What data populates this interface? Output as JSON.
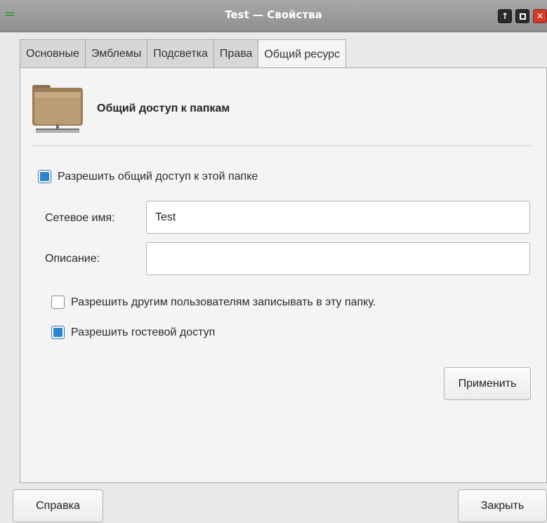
{
  "window": {
    "title": "Test — Свойства"
  },
  "tabs": [
    {
      "label": "Основные"
    },
    {
      "label": "Эмблемы"
    },
    {
      "label": "Подсветка"
    },
    {
      "label": "Права"
    },
    {
      "label": "Общий ресурс"
    }
  ],
  "active_tab": "Общий ресурс",
  "header": {
    "title": "Общий доступ к папкам",
    "icon": "folder-share-icon"
  },
  "share": {
    "enable_label": "Разрешить общий доступ к этой папке",
    "enable_checked": true,
    "network_name_label": "Сетевое имя:",
    "network_name_value": "Test",
    "description_label": "Описание:",
    "description_value": "",
    "allow_write_label": "Разрешить другим пользователям записывать в эту папку.",
    "allow_write_checked": false,
    "guest_access_label": "Разрешить гостевой доступ",
    "guest_access_checked": true,
    "apply_label": "Применить"
  },
  "footer": {
    "help_label": "Справка",
    "close_label": "Закрыть"
  },
  "colors": {
    "titlebar": "#9a9a9a",
    "checkbox_accent": "#2a84d2",
    "close_button": "#d33a2a"
  }
}
